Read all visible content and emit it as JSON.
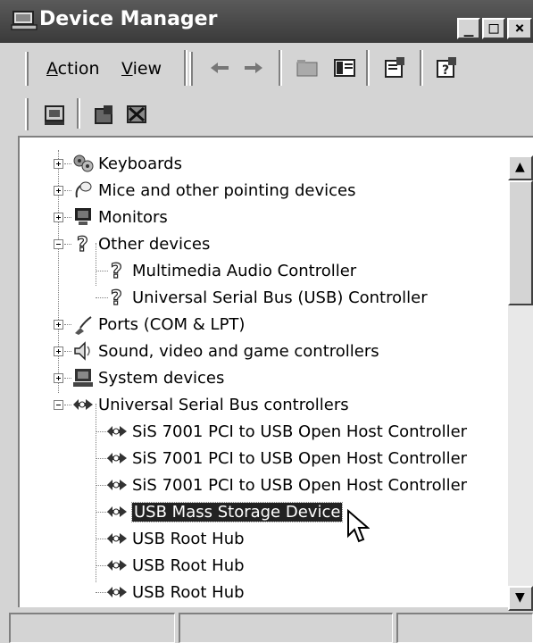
{
  "window": {
    "title": "Device Manager",
    "controls": {
      "minimize": "_",
      "maximize": "□",
      "close": "×"
    }
  },
  "menu": {
    "action": "Action",
    "action_mnemonic": "A",
    "action_rest": "ction",
    "view": "View",
    "view_mnemonic": "V",
    "view_rest": "iew"
  },
  "toolbar": {
    "icons": [
      "back-arrow-icon",
      "forward-arrow-icon",
      "up-folder-icon",
      "show-hide-tree-icon",
      "properties-icon",
      "help-icon"
    ]
  },
  "toolbar2": {
    "icons": [
      "scan-hardware-icon",
      "update-driver-icon",
      "uninstall-icon"
    ]
  },
  "tree": {
    "items": [
      {
        "label": "Keyboards",
        "icon": "keyboard-icon",
        "level": 0,
        "expander": "plus"
      },
      {
        "label": "Mice and other pointing devices",
        "icon": "mouse-icon",
        "level": 0,
        "expander": "plus"
      },
      {
        "label": "Monitors",
        "icon": "monitor-icon",
        "level": 0,
        "expander": "plus"
      },
      {
        "label": "Other devices",
        "icon": "unknown-device-icon",
        "level": 0,
        "expander": "minus"
      },
      {
        "label": "Multimedia Audio Controller",
        "icon": "unknown-device-icon",
        "level": 1
      },
      {
        "label": "Universal Serial Bus (USB) Controller",
        "icon": "unknown-device-icon",
        "level": 1
      },
      {
        "label": "Ports (COM & LPT)",
        "icon": "port-icon",
        "level": 0,
        "expander": "plus"
      },
      {
        "label": "Sound, video and game controllers",
        "icon": "speaker-icon",
        "level": 0,
        "expander": "plus"
      },
      {
        "label": "System devices",
        "icon": "computer-icon",
        "level": 0,
        "expander": "plus"
      },
      {
        "label": "Universal Serial Bus controllers",
        "icon": "usb-icon",
        "level": 0,
        "expander": "minus"
      },
      {
        "label": "SiS 7001 PCI to USB Open Host Controller",
        "icon": "usb-icon",
        "level": 1
      },
      {
        "label": "SiS 7001 PCI to USB Open Host Controller",
        "icon": "usb-icon",
        "level": 1
      },
      {
        "label": "SiS 7001 PCI to USB Open Host Controller",
        "icon": "usb-icon",
        "level": 1
      },
      {
        "label": "USB Mass Storage Device",
        "icon": "usb-icon",
        "level": 1,
        "selected": true
      },
      {
        "label": "USB Root Hub",
        "icon": "usb-icon",
        "level": 1
      },
      {
        "label": "USB Root Hub",
        "icon": "usb-icon",
        "level": 1
      },
      {
        "label": "USB Root Hub",
        "icon": "usb-icon",
        "level": 1
      }
    ]
  },
  "scrollbar": {
    "up": "▲",
    "down": "▼"
  },
  "colors": {
    "selection": "#222222",
    "titlebar": "#4a4a4a"
  }
}
